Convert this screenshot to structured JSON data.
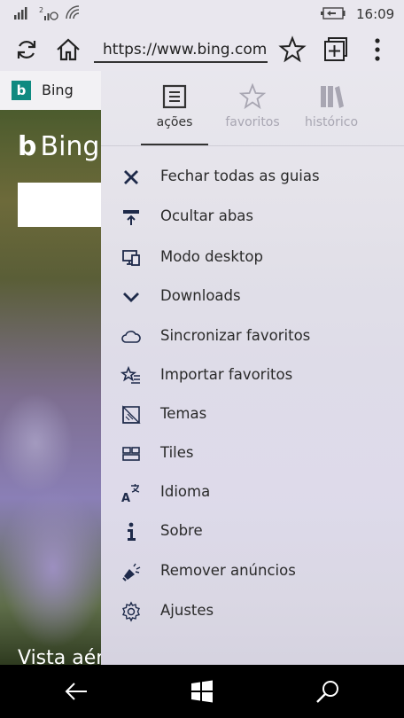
{
  "status": {
    "time": "16:09"
  },
  "toolbar": {
    "url": "https://www.bing.com"
  },
  "tab": {
    "label": "Bing",
    "icon": "bing-b-icon"
  },
  "page": {
    "logo_text": "Bing",
    "caption": "Vista aérea"
  },
  "panel": {
    "tabs": [
      {
        "label": "ações",
        "icon": "actions-icon",
        "active": true
      },
      {
        "label": "favoritos",
        "icon": "star-icon",
        "active": false
      },
      {
        "label": "histórico",
        "icon": "books-icon",
        "active": false
      }
    ],
    "items": [
      {
        "label": "Fechar todas as guias",
        "icon": "close-icon"
      },
      {
        "label": "Ocultar abas",
        "icon": "hide-tabs-icon"
      },
      {
        "label": "Modo desktop",
        "icon": "desktop-icon"
      },
      {
        "label": "Downloads",
        "icon": "chevron-down-icon"
      },
      {
        "label": "Sincronizar favoritos",
        "icon": "cloud-icon"
      },
      {
        "label": "Importar favoritos",
        "icon": "import-star-icon"
      },
      {
        "label": "Temas",
        "icon": "themes-icon"
      },
      {
        "label": "Tiles",
        "icon": "tiles-icon"
      },
      {
        "label": "Idioma",
        "icon": "language-icon"
      },
      {
        "label": "Sobre",
        "icon": "info-icon"
      },
      {
        "label": "Remover anúncios",
        "icon": "megaphone-icon"
      },
      {
        "label": "Ajustes",
        "icon": "gear-icon"
      }
    ]
  },
  "colors": {
    "chrome": "#e9e7ee",
    "bing_teal": "#0f8a80"
  }
}
